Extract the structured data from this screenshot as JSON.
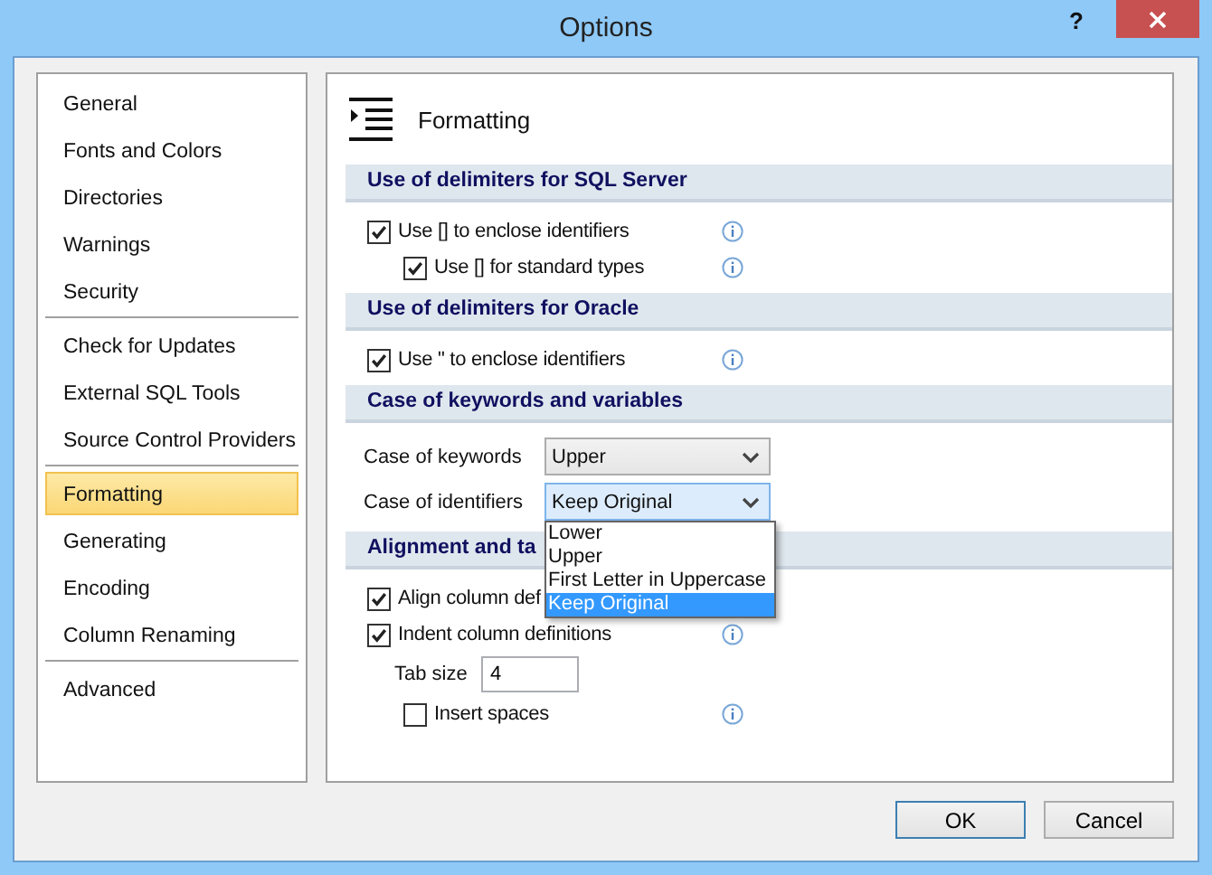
{
  "window": {
    "title": "Options",
    "help": "?"
  },
  "sidebar": {
    "groups": [
      [
        {
          "label": "General",
          "selected": false
        },
        {
          "label": "Fonts and Colors",
          "selected": false
        },
        {
          "label": "Directories",
          "selected": false
        },
        {
          "label": "Warnings",
          "selected": false
        },
        {
          "label": "Security",
          "selected": false
        }
      ],
      [
        {
          "label": "Check for Updates",
          "selected": false
        },
        {
          "label": "External SQL Tools",
          "selected": false
        },
        {
          "label": "Source Control Providers",
          "selected": false
        }
      ],
      [
        {
          "label": "Formatting",
          "selected": true
        },
        {
          "label": "Generating",
          "selected": false
        },
        {
          "label": "Encoding",
          "selected": false
        },
        {
          "label": "Column Renaming",
          "selected": false
        }
      ],
      [
        {
          "label": "Advanced",
          "selected": false
        }
      ]
    ]
  },
  "page": {
    "title": "Formatting",
    "sections": [
      {
        "heading": "Use of delimiters for SQL Server",
        "rows": [
          {
            "kind": "checkbox",
            "label": "Use [] to enclose identifiers",
            "checked": true,
            "info": true,
            "children": [
              {
                "kind": "checkbox",
                "label": "Use [] for standard types",
                "checked": true,
                "info": true
              }
            ]
          }
        ]
      },
      {
        "heading": "Use of delimiters for Oracle",
        "rows": [
          {
            "kind": "checkbox",
            "label": "Use \" to enclose identifiers",
            "checked": true,
            "info": true
          }
        ]
      },
      {
        "heading": "Case of keywords and variables",
        "rows": [
          {
            "kind": "select",
            "label": "Case of keywords",
            "value": "Upper",
            "expanded": false
          },
          {
            "kind": "select",
            "label": "Case of identifiers",
            "value": "Keep Original",
            "expanded": true,
            "options": [
              {
                "label": "Lower",
                "selected": false
              },
              {
                "label": "Upper",
                "selected": false
              },
              {
                "label": "First Letter in Uppercase",
                "selected": false
              },
              {
                "label": "Keep Original",
                "selected": true
              }
            ]
          }
        ]
      },
      {
        "heading": "Alignment and ta",
        "rows": [
          {
            "kind": "checkbox",
            "label": "Align column def",
            "checked": true,
            "info": false
          },
          {
            "kind": "checkbox",
            "label": "Indent column definitions",
            "checked": true,
            "info": true,
            "children": [
              {
                "kind": "field",
                "label": "Tab size",
                "value": "4"
              },
              {
                "kind": "checkbox",
                "label": "Insert spaces",
                "checked": false,
                "info": true
              }
            ]
          }
        ]
      }
    ]
  },
  "buttons": [
    "OK",
    "Cancel"
  ]
}
